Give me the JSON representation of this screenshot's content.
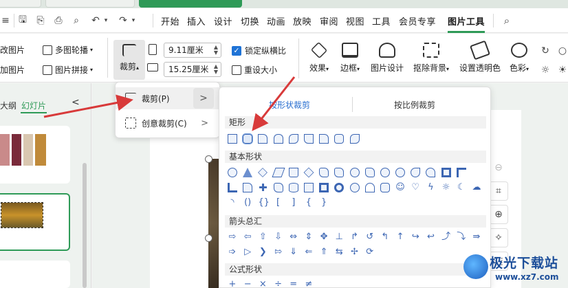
{
  "menu": {
    "items": [
      "开始",
      "插入",
      "设计",
      "切换",
      "动画",
      "放映",
      "审阅",
      "视图",
      "工具",
      "会员专享",
      "图片工具"
    ],
    "active": "图片工具"
  },
  "ribbon": {
    "modify_picture": "改图片",
    "multi_outline": "多图轮播",
    "add_picture": "加图片",
    "picture_stitch": "图片拼接",
    "crop": "裁剪",
    "width_value": "9.11厘米",
    "height_value": "15.25厘米",
    "lock_ratio": "锁定纵横比",
    "reset_size": "重设大小",
    "effects": "效果",
    "border": "边框",
    "picture_design": "图片设计",
    "remove_bg": "抠除背景",
    "set_transparent": "设置透明色",
    "color": "色彩"
  },
  "left_panel": {
    "tab_outline": "大纲",
    "tab_slides": "幻灯片",
    "collapse": "<"
  },
  "crop_menu": {
    "crop": "裁剪(P)",
    "creative_crop": "创意裁剪(C)",
    "chevron": ">"
  },
  "shape_panel": {
    "tab_by_shape": "按形状裁剪",
    "tab_by_ratio": "按比例裁剪",
    "section_rect": "矩形",
    "section_basic": "基本形状",
    "section_arrows": "箭头总汇",
    "section_formula": "公式形状",
    "formula_glyphs": [
      "+",
      "−",
      "×",
      "÷",
      "=",
      "≠"
    ]
  },
  "watermark": {
    "title": "极光下载站",
    "url": "www.xz7.com"
  },
  "colors": {
    "accent_green": "#2e9a57",
    "accent_blue": "#2a6fd0",
    "annotation_red": "#d83a3a"
  }
}
